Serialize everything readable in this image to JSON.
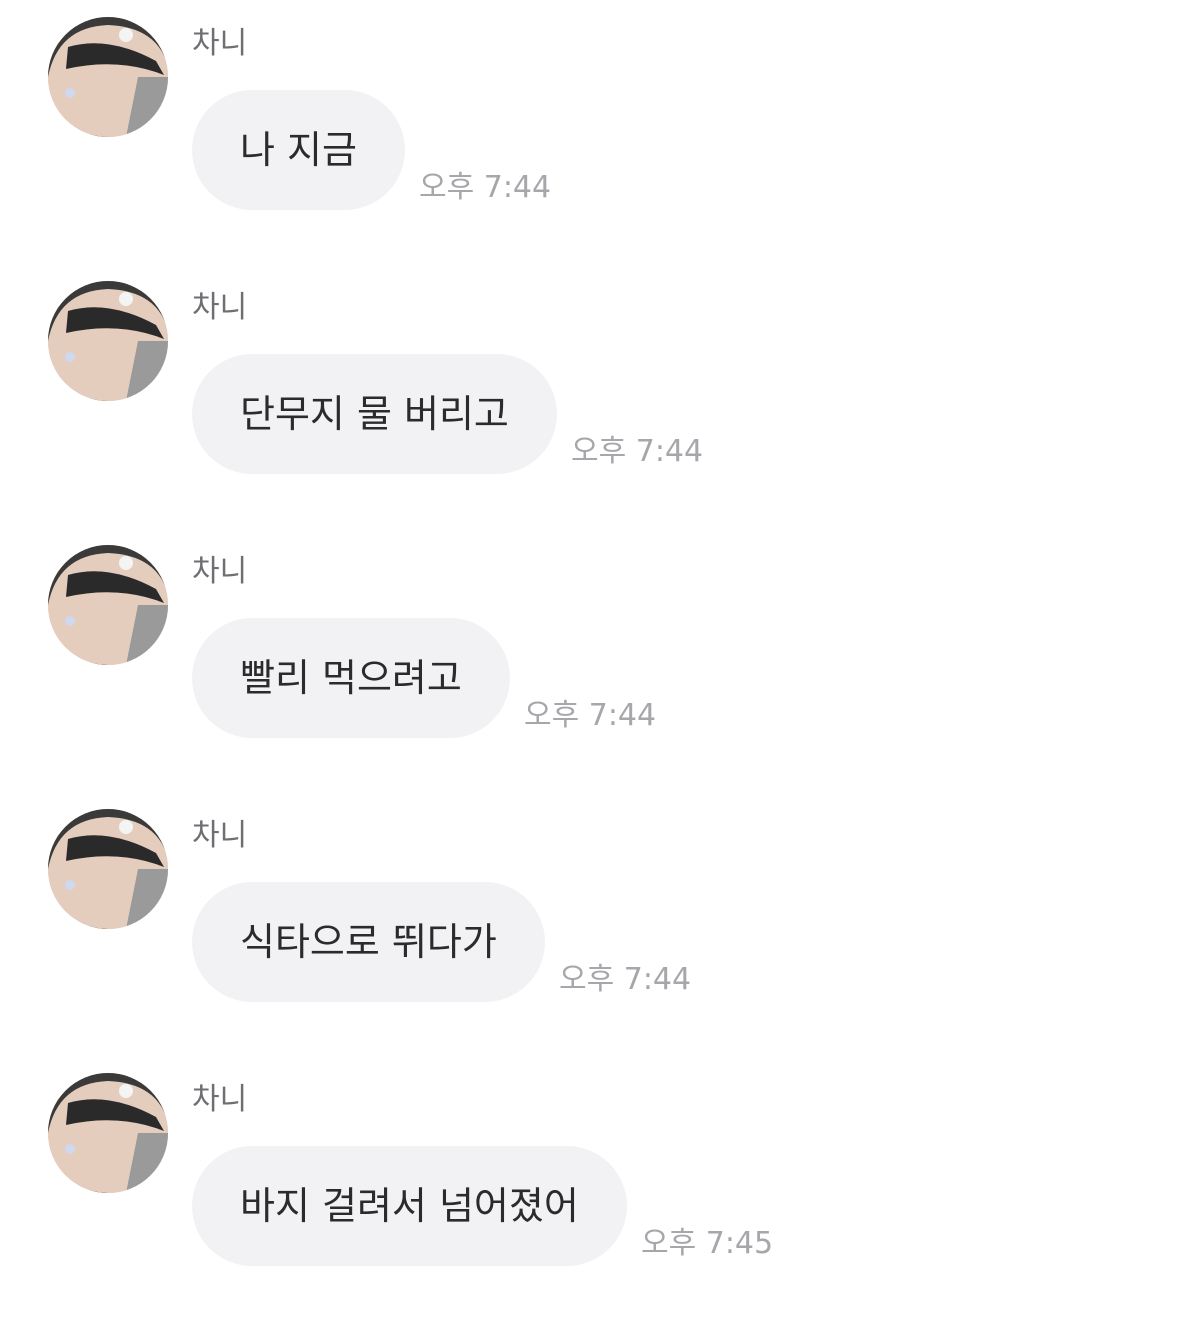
{
  "messages": [
    {
      "sender": "차니",
      "text": "나 지금",
      "time": "오후 7:44"
    },
    {
      "sender": "차니",
      "text": "단무지 물 버리고",
      "time": "오후 7:44"
    },
    {
      "sender": "차니",
      "text": "빨리 먹으려고",
      "time": "오후 7:44"
    },
    {
      "sender": "차니",
      "text": "식타으로 뛰다가",
      "time": "오후 7:44"
    },
    {
      "sender": "차니",
      "text": "바지 걸려서 넘어졌어",
      "time": "오후 7:45"
    }
  ],
  "colors": {
    "bubble": "#f2f2f5",
    "message_text": "#2b2b2e",
    "sender_name": "#6e6e73",
    "timestamp": "#a6a6ab",
    "background": "#ffffff"
  }
}
